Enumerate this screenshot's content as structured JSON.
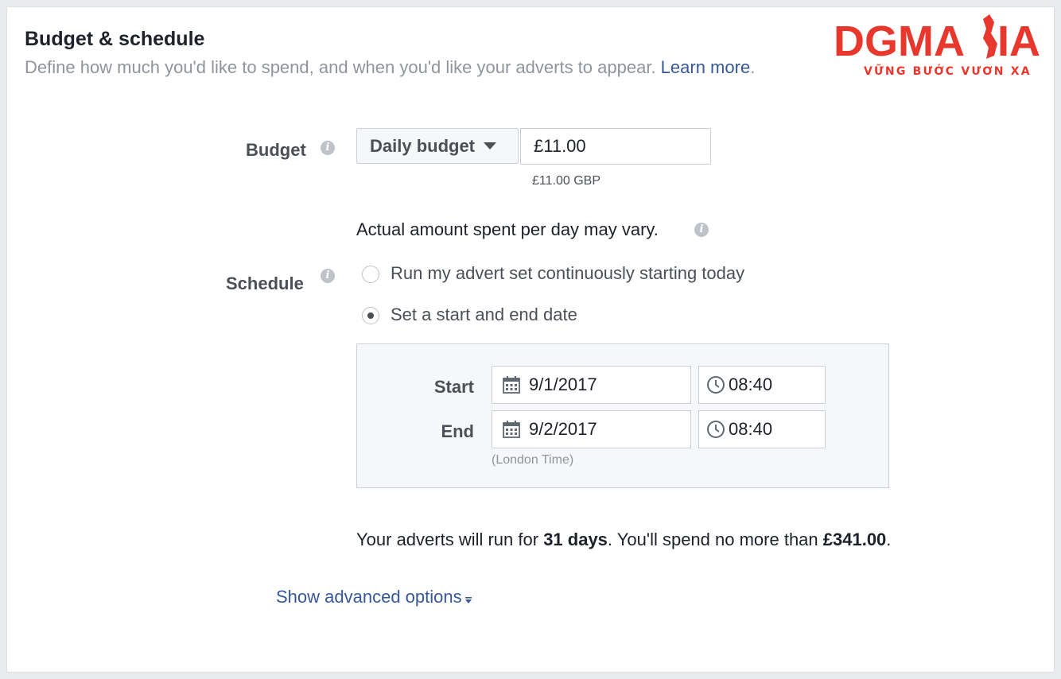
{
  "header": {
    "title": "Budget & schedule",
    "subtitle": "Define how much you'd like to spend, and when you'd like your adverts to appear.",
    "learn_more": "Learn more",
    "period": "."
  },
  "logo": {
    "text_a": "DGMA",
    "text_b": "IA",
    "tagline": "VỮNG BƯỚC VƯƠN XA",
    "color": "#e8372c"
  },
  "budget": {
    "label": "Budget",
    "type_selected": "Daily budget",
    "amount": "£11.00",
    "converted": "£11.00 GBP",
    "note": "Actual amount spent per day may vary."
  },
  "schedule": {
    "label": "Schedule",
    "options": [
      {
        "label": "Run my advert set continuously starting today",
        "selected": false
      },
      {
        "label": "Set a start and end date",
        "selected": true
      }
    ],
    "start": {
      "label": "Start",
      "date": "9/1/2017",
      "time": "08:40"
    },
    "end": {
      "label": "End",
      "date": "9/2/2017",
      "time": "08:40"
    },
    "timezone": "(London Time)"
  },
  "summary": {
    "prefix": "Your adverts will run for ",
    "duration": "31 days",
    "middle": ". You'll spend no more than ",
    "total": "£341.00",
    "suffix": "."
  },
  "advanced": {
    "label": "Show advanced options"
  },
  "icons": {
    "info": "info-icon",
    "calendar": "calendar-icon",
    "clock": "clock-icon",
    "dropdown": "caret-down-icon"
  },
  "colors": {
    "link": "#365899",
    "panel": "#f6f7f9",
    "accent": "#e8372c"
  }
}
